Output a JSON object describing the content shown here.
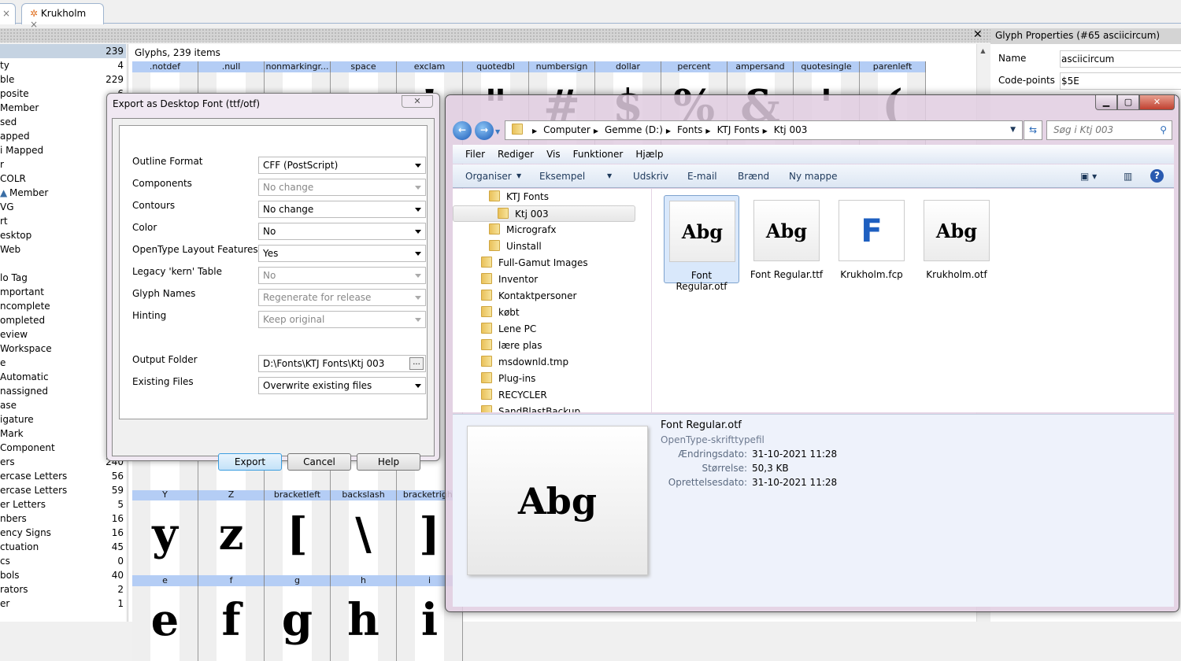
{
  "tabs": [
    {
      "label": ""
    },
    {
      "label": "Krukholm"
    }
  ],
  "sidebar": {
    "items": [
      {
        "label": "",
        "count": "239"
      },
      {
        "label": "ty",
        "count": "4"
      },
      {
        "label": "ble",
        "count": "229"
      },
      {
        "label": "posite",
        "count": "6"
      },
      {
        "label": "Member",
        "count": ""
      },
      {
        "label": "sed",
        "count": ""
      },
      {
        "label": "apped",
        "count": ""
      },
      {
        "label": "i Mapped",
        "count": ""
      },
      {
        "label": "r",
        "count": ""
      },
      {
        "label": "COLR",
        "count": ""
      },
      {
        "label": "Member",
        "count": ""
      },
      {
        "label": "VG",
        "count": ""
      },
      {
        "label": "rt",
        "count": ""
      },
      {
        "label": "esktop",
        "count": ""
      },
      {
        "label": "Web",
        "count": ""
      },
      {
        "label": "",
        "count": ""
      },
      {
        "label": "lo Tag",
        "count": ""
      },
      {
        "label": "mportant",
        "count": ""
      },
      {
        "label": "ncomplete",
        "count": ""
      },
      {
        "label": "ompleted",
        "count": ""
      },
      {
        "label": "eview",
        "count": ""
      },
      {
        "label": "Workspace",
        "count": ""
      },
      {
        "label": "e",
        "count": ""
      },
      {
        "label": "Automatic",
        "count": ""
      },
      {
        "label": "nassigned",
        "count": ""
      },
      {
        "label": "ase",
        "count": ""
      },
      {
        "label": "igature",
        "count": ""
      },
      {
        "label": "Mark",
        "count": ""
      },
      {
        "label": "Component",
        "count": ""
      },
      {
        "label": "ers",
        "count": "240"
      },
      {
        "label": "ercase Letters",
        "count": "56"
      },
      {
        "label": "ercase Letters",
        "count": "59"
      },
      {
        "label": "er Letters",
        "count": "5"
      },
      {
        "label": "nbers",
        "count": "16"
      },
      {
        "label": "ency Signs",
        "count": "16"
      },
      {
        "label": "ctuation",
        "count": "45"
      },
      {
        "label": "cs",
        "count": "0"
      },
      {
        "label": "bols",
        "count": "40"
      },
      {
        "label": "rators",
        "count": "2"
      },
      {
        "label": "er",
        "count": "1"
      }
    ]
  },
  "glyphs": {
    "title": "Glyphs, 239 items",
    "row1": [
      {
        "name": ".notdef",
        "g": ""
      },
      {
        "name": ".null",
        "g": ""
      },
      {
        "name": "nonmarkingr...",
        "g": ""
      },
      {
        "name": "space",
        "g": ""
      },
      {
        "name": "exclam",
        "g": "!"
      },
      {
        "name": "quotedbl",
        "g": "\""
      },
      {
        "name": "numbersign",
        "g": "#"
      },
      {
        "name": "dollar",
        "g": "$"
      },
      {
        "name": "percent",
        "g": "%"
      },
      {
        "name": "ampersand",
        "g": "&"
      },
      {
        "name": "quotesingle",
        "g": "'"
      },
      {
        "name": "parenleft",
        "g": "("
      }
    ],
    "row6": [
      {
        "name": "Y",
        "g": "y"
      },
      {
        "name": "Z",
        "g": "z"
      },
      {
        "name": "bracketleft",
        "g": "["
      },
      {
        "name": "backslash",
        "g": "\\"
      },
      {
        "name": "bracketright",
        "g": "]"
      }
    ],
    "row7": [
      {
        "name": "e",
        "g": "e"
      },
      {
        "name": "f",
        "g": "f"
      },
      {
        "name": "g",
        "g": "g"
      },
      {
        "name": "h",
        "g": "h"
      },
      {
        "name": "i",
        "g": "i"
      }
    ]
  },
  "properties": {
    "title": "Glyph Properties (#65 asciicircum)",
    "name_label": "Name",
    "name_value": "asciicircum",
    "cp_label": "Code-points",
    "cp_value": "$5E"
  },
  "dialog": {
    "title": "Export as Desktop Font (ttf/otf)",
    "fields": [
      {
        "label": "Outline Format",
        "value": "CFF (PostScript)",
        "enabled": true
      },
      {
        "label": "Components",
        "value": "No change",
        "enabled": false
      },
      {
        "label": "Contours",
        "value": "No change",
        "enabled": true
      },
      {
        "label": "Color",
        "value": "No",
        "enabled": true
      },
      {
        "label": "OpenType Layout Features",
        "value": "Yes",
        "enabled": true
      },
      {
        "label": "Legacy 'kern' Table",
        "value": "No",
        "enabled": false
      },
      {
        "label": "Glyph Names",
        "value": "Regenerate for release",
        "enabled": false
      },
      {
        "label": "Hinting",
        "value": "Keep original",
        "enabled": false
      }
    ],
    "output_label": "Output Folder",
    "output_value": "D:\\Fonts\\KTJ Fonts\\Ktj 003",
    "browse": "...",
    "existing_label": "Existing Files",
    "existing_value": "Overwrite existing files",
    "export": "Export",
    "cancel": "Cancel",
    "help": "Help"
  },
  "explorer": {
    "breadcrumb": [
      "Computer",
      "Gemme (D:)",
      "Fonts",
      "KTJ Fonts",
      "Ktj 003"
    ],
    "search_placeholder": "Søg i Ktj 003",
    "menu": [
      "Filer",
      "Rediger",
      "Vis",
      "Funktioner",
      "Hjælp"
    ],
    "toolbar": [
      "Organiser",
      "Eksempel",
      "Udskriv",
      "E-mail",
      "Brænd",
      "Ny mappe"
    ],
    "nav": [
      {
        "label": "KTJ Fonts",
        "level": 2
      },
      {
        "label": "Ktj 003",
        "level": 3,
        "selected": true
      },
      {
        "label": "Micrografx",
        "level": 2
      },
      {
        "label": "Uinstall",
        "level": 2
      },
      {
        "label": "Full-Gamut Images",
        "level": 1
      },
      {
        "label": "Inventor",
        "level": 1
      },
      {
        "label": "Kontaktpersoner",
        "level": 1
      },
      {
        "label": "købt",
        "level": 1
      },
      {
        "label": "Lene PC",
        "level": 1
      },
      {
        "label": "lære plas",
        "level": 1
      },
      {
        "label": "msdownld.tmp",
        "level": 1
      },
      {
        "label": "Plug-ins",
        "level": 1
      },
      {
        "label": "RECYCLER",
        "level": 1
      },
      {
        "label": "SandBlastBackup",
        "level": 1
      }
    ],
    "files": [
      {
        "name": "Font Regular.otf",
        "preview": "Abg",
        "selected": true
      },
      {
        "name": "Font Regular.ttf",
        "preview": "Abg"
      },
      {
        "name": "Krukholm.fcp",
        "preview": "F"
      },
      {
        "name": "Krukholm.otf",
        "preview": "Abg"
      }
    ],
    "details": {
      "name": "Font Regular.otf",
      "type": "OpenType-skrifttypefil",
      "preview": "Abg",
      "rows": [
        {
          "k": "Ændringsdato:",
          "v": "31-10-2021 11:28"
        },
        {
          "k": "Størrelse:",
          "v": "50,3 KB"
        },
        {
          "k": "Oprettelsesdato:",
          "v": "31-10-2021 11:28"
        }
      ]
    }
  },
  "colors": {
    "accent": "#b4cdf5",
    "selection": "#cce4f7"
  }
}
